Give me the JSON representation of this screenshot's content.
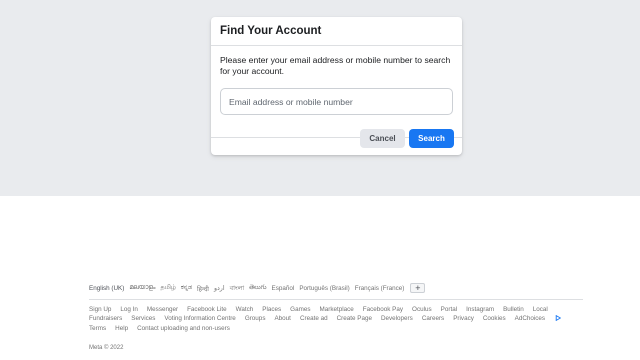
{
  "dialog": {
    "title": "Find Your Account",
    "instructions": "Please enter your email address or mobile number to search for your account.",
    "input_placeholder": "Email address or mobile number",
    "input_value": "",
    "cancel_label": "Cancel",
    "search_label": "Search"
  },
  "footer": {
    "languages": [
      "English (UK)",
      "മലയാളം",
      "தமிழ்",
      "ಕನ್ನಡ",
      "हिन्दी",
      "اردو",
      "বাংলা",
      "తెలుగు",
      "Español",
      "Português (Brasil)",
      "Français (France)"
    ],
    "more_languages_label": "+",
    "links": [
      "Sign Up",
      "Log In",
      "Messenger",
      "Facebook Lite",
      "Watch",
      "Places",
      "Games",
      "Marketplace",
      "Facebook Pay",
      "Oculus",
      "Portal",
      "Instagram",
      "Bulletin",
      "Local",
      "Fundraisers",
      "Services",
      "Voting Information Centre",
      "Groups",
      "About",
      "Create ad",
      "Create Page",
      "Developers",
      "Careers",
      "Privacy",
      "Cookies",
      "AdChoices",
      "Terms",
      "Help",
      "Contact uploading and non-users"
    ],
    "copyright": "Meta © 2022"
  },
  "colors": {
    "background_top": "#e9ebee",
    "accent": "#1877f2",
    "adchoices": "#1877f2"
  },
  "icons": {
    "adchoices": "adchoices-icon",
    "more_languages": "plus-icon"
  }
}
